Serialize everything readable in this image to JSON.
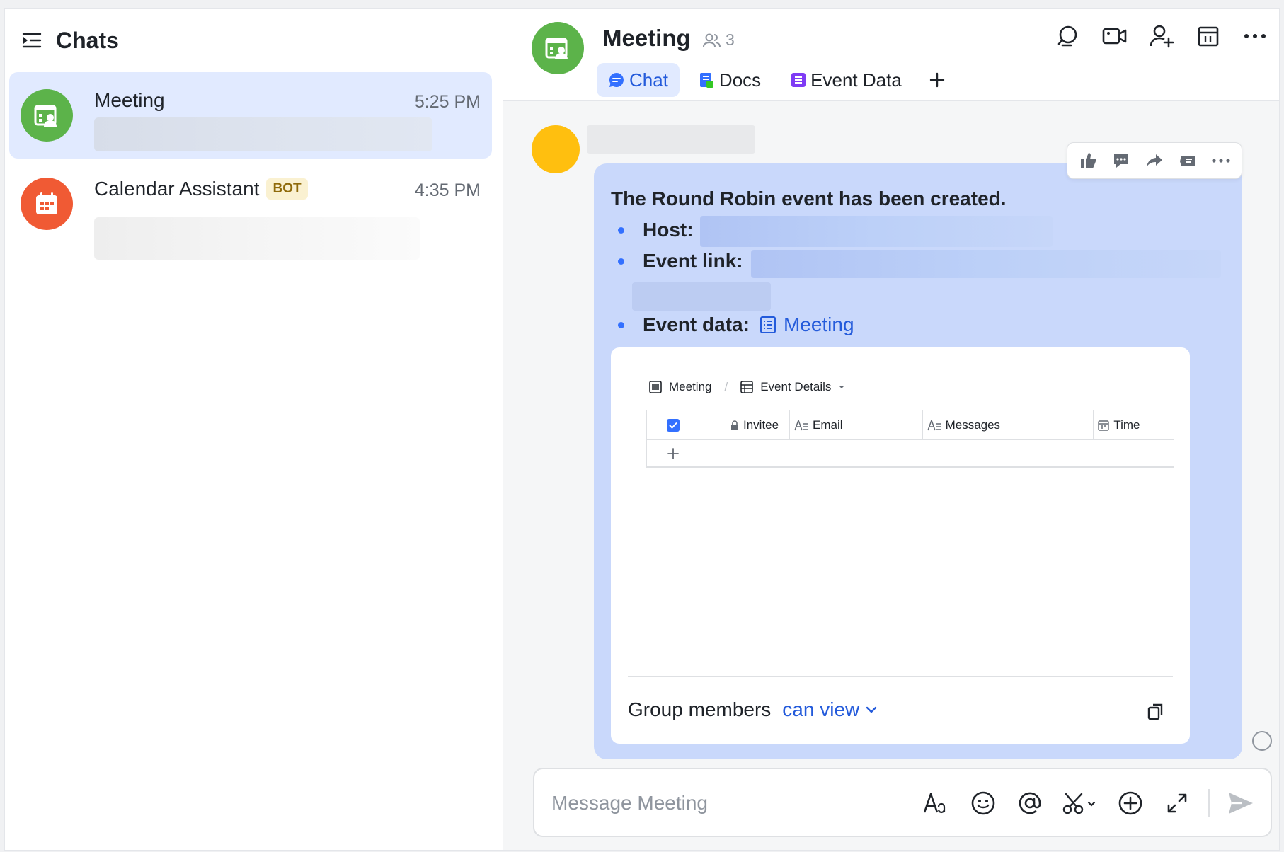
{
  "sidebar": {
    "title": "Chats",
    "chats": [
      {
        "name": "Meeting",
        "time": "5:25 PM",
        "avatar_color": "#5cb34a",
        "active": true
      },
      {
        "name": "Calendar Assistant",
        "badge": "BOT",
        "time": "4:35 PM",
        "avatar_color": "#f05a34",
        "active": false
      }
    ]
  },
  "header": {
    "title": "Meeting",
    "member_count": "3",
    "tabs": [
      {
        "label": "Chat",
        "active": true
      },
      {
        "label": "Docs",
        "active": false
      },
      {
        "label": "Event Data",
        "active": false
      }
    ],
    "actions": [
      "search-icon",
      "video-call-icon",
      "add-member-icon",
      "calendar-icon",
      "more-icon"
    ]
  },
  "message": {
    "title": "The Round Robin event has been created.",
    "host_label": "Host:",
    "event_link_label": "Event link:",
    "event_data_label": "Event data:",
    "event_data_link": "Meeting",
    "reactions": [
      "thumbs-up-icon",
      "reply-icon",
      "forward-icon",
      "quote-icon",
      "more-icon"
    ],
    "card": {
      "crumb_base": "Meeting",
      "crumb_view": "Event Details",
      "columns": [
        "Invitee",
        "Email",
        "Messages",
        "Time"
      ],
      "permission_label": "Group members",
      "permission_value": "can view"
    }
  },
  "composer": {
    "placeholder": "Message Meeting"
  },
  "colors": {
    "accent": "#3370ff",
    "bubble": "#c9d8fb",
    "active_chat": "#e1eaff"
  }
}
